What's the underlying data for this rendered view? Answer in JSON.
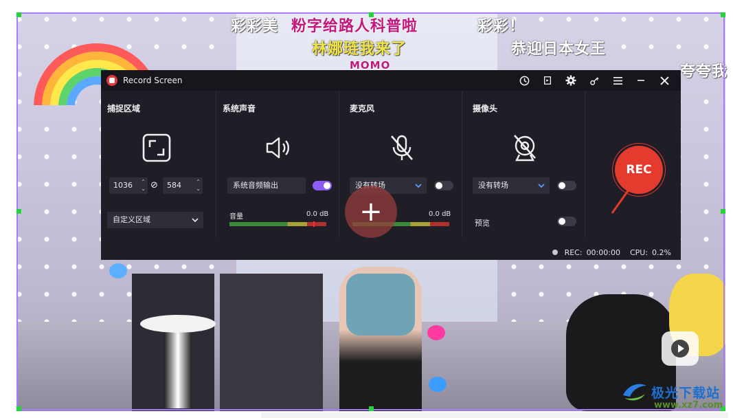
{
  "subtitles": {
    "line1_left": "彩彩美",
    "line1_magenta": "粉字给路人科普啦",
    "line1_right": "彩彩！",
    "line2_yellow": "林娜琏我来了",
    "line2_right": "恭迎日本女王",
    "line3_magenta": "MOMO",
    "edge_right": "夸夸我"
  },
  "app": {
    "title": "Record Screen",
    "title_icons": [
      "history-icon",
      "crop-icon",
      "gear-icon",
      "key-icon",
      "menu-icon",
      "minimize-icon",
      "close-icon"
    ],
    "sections": {
      "capture": {
        "title": "捕捉区域",
        "width": "1036",
        "height": "584",
        "region_mode": "自定义区域"
      },
      "system_audio": {
        "title": "系统声音",
        "device": "系统音频输出",
        "enabled": true,
        "meter_label": "音量",
        "meter_value": "0.0 dB"
      },
      "microphone": {
        "title": "麦克风",
        "device": "没有转场",
        "enabled": false,
        "meter_value": "0.0 dB"
      },
      "camera": {
        "title": "摄像头",
        "device": "没有转场",
        "enabled": false,
        "preview_label": "预览",
        "preview_enabled": false
      }
    },
    "rec_button": "REC",
    "status": {
      "rec_label": "REC:",
      "rec_time": "00:00:00",
      "cpu_label": "CPU:",
      "cpu_value": "0.2%"
    }
  },
  "overlay": {
    "add_symbol": "+"
  },
  "watermark": {
    "text": "极光下载站",
    "url": "www.xz7.com"
  },
  "colors": {
    "panel_bg": "#1f1e26",
    "rec_red": "#e53a2e",
    "toggle_on": "#8b5cf6",
    "region_border": "#a77bff",
    "handle_green": "#26d43b"
  }
}
